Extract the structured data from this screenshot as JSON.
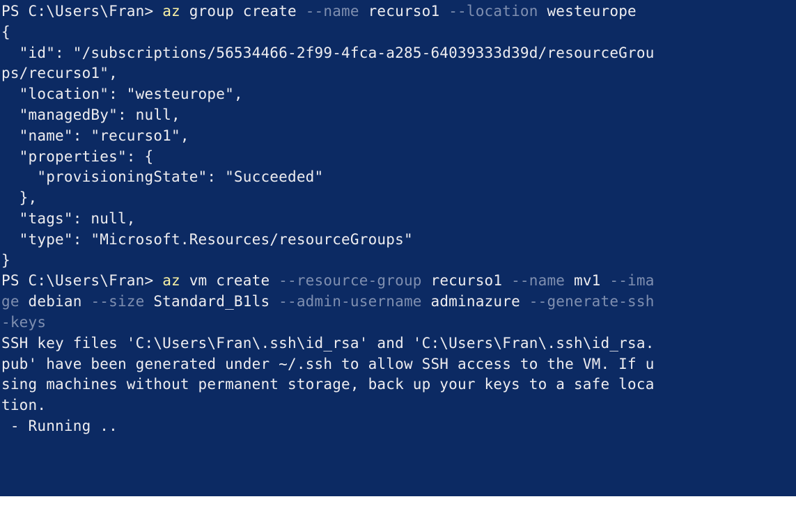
{
  "terminal": {
    "lines": [
      [
        {
          "t": "PS C:\\Users\\Fran> ",
          "c": "prompt"
        },
        {
          "t": "az",
          "c": "cmd"
        },
        {
          "t": " group create ",
          "c": ""
        },
        {
          "t": "--name",
          "c": "param"
        },
        {
          "t": " recurso1 ",
          "c": ""
        },
        {
          "t": "--location",
          "c": "param"
        },
        {
          "t": " westeurope",
          "c": ""
        }
      ],
      [
        {
          "t": "{",
          "c": ""
        }
      ],
      [
        {
          "t": "  \"id\": \"/subscriptions/56534466-2f99-4fca-a285-64039333d39d/resourceGrou",
          "c": ""
        }
      ],
      [
        {
          "t": "ps/recurso1\",",
          "c": ""
        }
      ],
      [
        {
          "t": "  \"location\": \"westeurope\",",
          "c": ""
        }
      ],
      [
        {
          "t": "  \"managedBy\": null,",
          "c": ""
        }
      ],
      [
        {
          "t": "  \"name\": \"recurso1\",",
          "c": ""
        }
      ],
      [
        {
          "t": "  \"properties\": {",
          "c": ""
        }
      ],
      [
        {
          "t": "    \"provisioningState\": \"Succeeded\"",
          "c": ""
        }
      ],
      [
        {
          "t": "  },",
          "c": ""
        }
      ],
      [
        {
          "t": "  \"tags\": null,",
          "c": ""
        }
      ],
      [
        {
          "t": "  \"type\": \"Microsoft.Resources/resourceGroups\"",
          "c": ""
        }
      ],
      [
        {
          "t": "}",
          "c": ""
        }
      ],
      [
        {
          "t": "PS C:\\Users\\Fran> ",
          "c": "prompt"
        },
        {
          "t": "az",
          "c": "cmd"
        },
        {
          "t": " vm create ",
          "c": ""
        },
        {
          "t": "--resource-group",
          "c": "param"
        },
        {
          "t": " recurso1 ",
          "c": ""
        },
        {
          "t": "--name",
          "c": "param"
        },
        {
          "t": " mv1 ",
          "c": ""
        },
        {
          "t": "--ima",
          "c": "param"
        }
      ],
      [
        {
          "t": "ge",
          "c": "param"
        },
        {
          "t": " debian ",
          "c": ""
        },
        {
          "t": "--size",
          "c": "param"
        },
        {
          "t": " Standard_B1ls ",
          "c": ""
        },
        {
          "t": "--admin-username",
          "c": "param"
        },
        {
          "t": " adminazure ",
          "c": ""
        },
        {
          "t": "--generate-ssh",
          "c": "param"
        }
      ],
      [
        {
          "t": "-keys",
          "c": "param"
        }
      ],
      [
        {
          "t": "SSH key files 'C:\\Users\\Fran\\.ssh\\id_rsa' and 'C:\\Users\\Fran\\.ssh\\id_rsa.",
          "c": ""
        }
      ],
      [
        {
          "t": "pub' have been generated under ~/.ssh to allow SSH access to the VM. If u",
          "c": ""
        }
      ],
      [
        {
          "t": "sing machines without permanent storage, back up your keys to a safe loca",
          "c": ""
        }
      ],
      [
        {
          "t": "tion.",
          "c": ""
        }
      ],
      [
        {
          "t": " - Running ..",
          "c": ""
        }
      ]
    ]
  },
  "colors": {
    "background": "#0c2a63",
    "text": "#eeedf0",
    "command": "#f9f1a5",
    "parameter": "#7f8fb0"
  }
}
